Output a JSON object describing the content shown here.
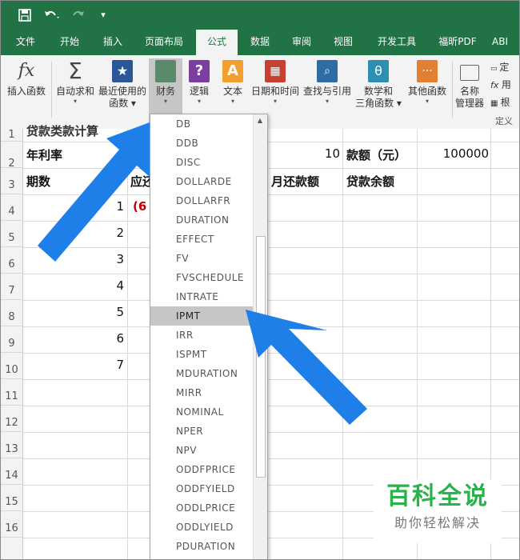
{
  "qat": {
    "save_icon": "save-icon",
    "undo_icon": "undo-icon",
    "redo_icon": "redo-icon",
    "customize_icon": "customize-icon"
  },
  "tabs": [
    "文件",
    "开始",
    "插入",
    "页面布局",
    "公式",
    "数据",
    "审阅",
    "视图",
    "开发工具",
    "福昕PDF",
    "ABI"
  ],
  "active_tab": "公式",
  "ribbon": {
    "insert_function": "插入函数",
    "autosum": "自动求和",
    "recent_line1": "最近使用的",
    "recent_line2": "函数",
    "financial": "财务",
    "logical": "逻辑",
    "text": "文本",
    "datetime": "日期和时间",
    "lookup": "查找与引用",
    "math_line1": "数学和",
    "math_line2": "三角函数",
    "more": "其他函数",
    "name_mgr_line1": "名称",
    "name_mgr_line2": "管理器",
    "side_define": "定",
    "side_use": "用",
    "side_from": "根",
    "group_label": "定义"
  },
  "rows": [
    "1",
    "2",
    "3",
    "4",
    "5",
    "6",
    "7",
    "8",
    "9",
    "10",
    "11",
    "12",
    "13",
    "14",
    "15",
    "16"
  ],
  "cells": {
    "r1_partial": "贷款类款计算",
    "annual_rate": "年利率",
    "years_value": "10",
    "amount_label": "款额（元）",
    "amount_value": "100000",
    "period": "期数",
    "interest_partial": "应还",
    "monthly_payment": "月还款额",
    "balance": "贷款余额",
    "r4_formula": "(6",
    "periods": [
      "1",
      "2",
      "3",
      "4",
      "5",
      "6",
      "7"
    ]
  },
  "dropdown": {
    "items": [
      "DB",
      "DDB",
      "DISC",
      "DOLLARDE",
      "DOLLARFR",
      "DURATION",
      "EFFECT",
      "FV",
      "FVSCHEDULE",
      "INTRATE",
      "IPMT",
      "IRR",
      "ISPMT",
      "MDURATION",
      "MIRR",
      "NOMINAL",
      "NPER",
      "NPV",
      "ODDFPRICE",
      "ODDFYIELD",
      "ODDLPRICE",
      "ODDLYIELD",
      "PDURATION"
    ],
    "selected": "IPMT"
  },
  "watermark": {
    "title": "百科全说",
    "subtitle": "助你轻松解决"
  },
  "colors": {
    "excel_green": "#217346",
    "arrow_blue": "#1e7fe8",
    "selected_bg": "#c6c6c6",
    "watermark_green": "#2bb24c"
  }
}
